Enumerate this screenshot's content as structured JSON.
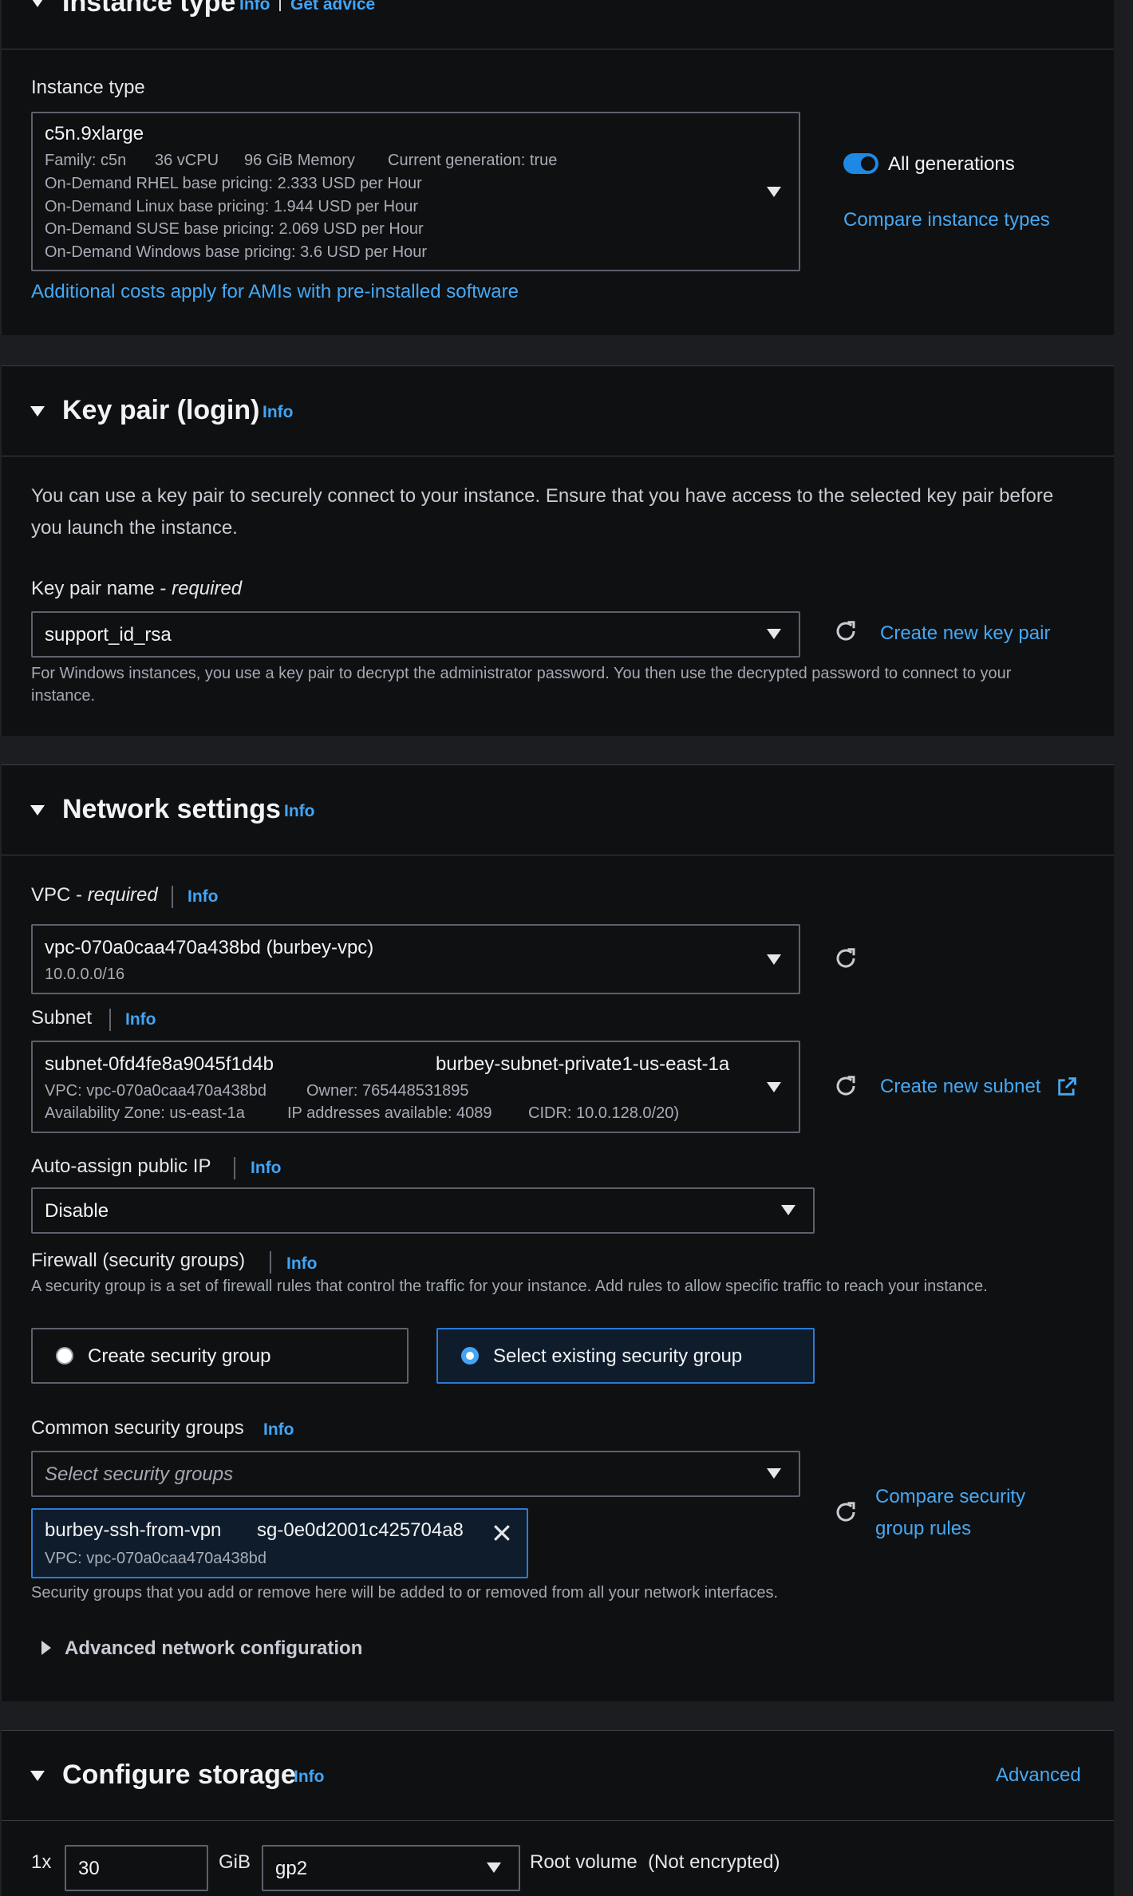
{
  "instance_type_section": {
    "title": "Instance type",
    "info": "Info",
    "get_advice": "Get advice",
    "field_label": "Instance type",
    "selected": "c5n.9xlarge",
    "family": "Family: c5n",
    "vcpu": "36 vCPU",
    "memory": "96 GiB Memory",
    "current_gen": "Current generation: true",
    "pricing": [
      "On-Demand RHEL base pricing: 2.333 USD per Hour",
      "On-Demand Linux base pricing: 1.944 USD per Hour",
      "On-Demand SUSE base pricing: 2.069 USD per Hour",
      "On-Demand Windows base pricing: 3.6 USD per Hour"
    ],
    "all_generations": "All generations",
    "compare_link": "Compare instance types",
    "additional_costs": "Additional costs apply for AMIs with pre-installed software"
  },
  "key_pair_section": {
    "title": "Key pair (login)",
    "info": "Info",
    "description": "You can use a key pair to securely connect to your instance. Ensure that you have access to the selected key pair before you launch the instance.",
    "field_label": "Key pair name - ",
    "required": "required",
    "selected": "support_id_rsa",
    "create_link": "Create new key pair",
    "help": "For Windows instances, you use a key pair to decrypt the administrator password. You then use the decrypted password to connect to your instance."
  },
  "network_section": {
    "title": "Network settings",
    "info": "Info",
    "vpc_label": "VPC - ",
    "vpc_required": "required",
    "vpc_info": "Info",
    "vpc_value": "vpc-070a0caa470a438bd (burbey-vpc)",
    "vpc_cidr": "10.0.0.0/16",
    "subnet_label": "Subnet",
    "subnet_info": "Info",
    "subnet_id": "subnet-0fd4fe8a9045f1d4b",
    "subnet_name": "burbey-subnet-private1-us-east-1a",
    "subnet_vpc": "VPC: vpc-070a0caa470a438bd",
    "subnet_owner": "Owner: 765448531895",
    "subnet_az": "Availability Zone: us-east-1a",
    "subnet_ips": "IP addresses available: 4089",
    "subnet_cidr": "CIDR: 10.0.128.0/20)",
    "create_subnet": "Create new subnet",
    "auto_ip_label": "Auto-assign public IP",
    "auto_ip_info": "Info",
    "auto_ip_value": "Disable",
    "firewall_label": "Firewall (security groups)",
    "firewall_info": "Info",
    "firewall_desc": "A security group is a set of firewall rules that control the traffic for your instance. Add rules to allow specific traffic to reach your instance.",
    "create_sg": "Create security group",
    "select_sg": "Select existing security group",
    "common_sg_label": "Common security groups",
    "common_sg_info": "Info",
    "sg_placeholder": "Select security groups",
    "compare_sg_1": "Compare security",
    "compare_sg_2": "group rules",
    "chip_name": "burbey-ssh-from-vpn",
    "chip_id": "sg-0e0d2001c425704a8",
    "chip_vpc": "VPC: vpc-070a0caa470a438bd",
    "sg_help": "Security groups that you add or remove here will be added to or removed from all your network interfaces.",
    "advanced_network": "Advanced network configuration"
  },
  "storage_section": {
    "title": "Configure storage",
    "info": "Info",
    "advanced": "Advanced",
    "multiplier": "1x",
    "size": "30",
    "unit": "GiB",
    "volume_type": "gp2",
    "root_volume": "Root volume  (Not encrypted)"
  },
  "colors": {
    "accent": "#42a5f5",
    "panel_bg": "#0f1012",
    "border": "#5c626b"
  }
}
